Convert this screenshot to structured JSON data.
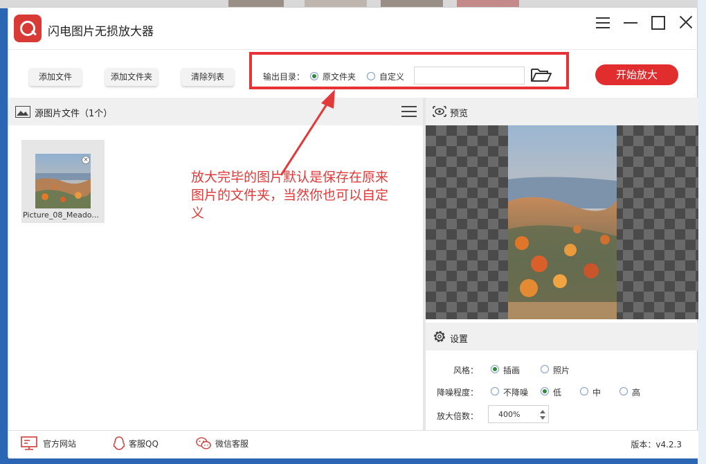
{
  "app": {
    "title": "闪电图片无损放大器"
  },
  "toolbar": {
    "add_file": "添加文件",
    "add_folder": "添加文件夹",
    "clear_list": "清除列表",
    "output_label": "输出目录：",
    "output_original": "原文件夹",
    "output_custom": "自定义",
    "output_path": "",
    "start": "开始放大"
  },
  "source": {
    "title": "源图片文件（1个）",
    "files": [
      {
        "name": "Picture_08_Meado..."
      }
    ]
  },
  "annotation": "放大完毕的图片默认是保存在原来图片的文件夹，当然你也可以自定义",
  "preview": {
    "title": "预览"
  },
  "settings": {
    "title": "设置",
    "style_label": "风格：",
    "style_options": [
      "插画",
      "照片"
    ],
    "style_selected": "插画",
    "denoise_label": "降噪程度：",
    "denoise_options": [
      "不降噪",
      "低",
      "中",
      "高"
    ],
    "denoise_selected": "低",
    "scale_label": "放大倍数：",
    "scale_value": "400%"
  },
  "footer": {
    "website": "官方网站",
    "qq": "客服QQ",
    "wechat": "微信客服",
    "version": "版本：v4.2.3"
  },
  "colors": {
    "accent": "#e12d2d",
    "annotation": "#e23a3a",
    "checked": "#2f8a3b"
  }
}
